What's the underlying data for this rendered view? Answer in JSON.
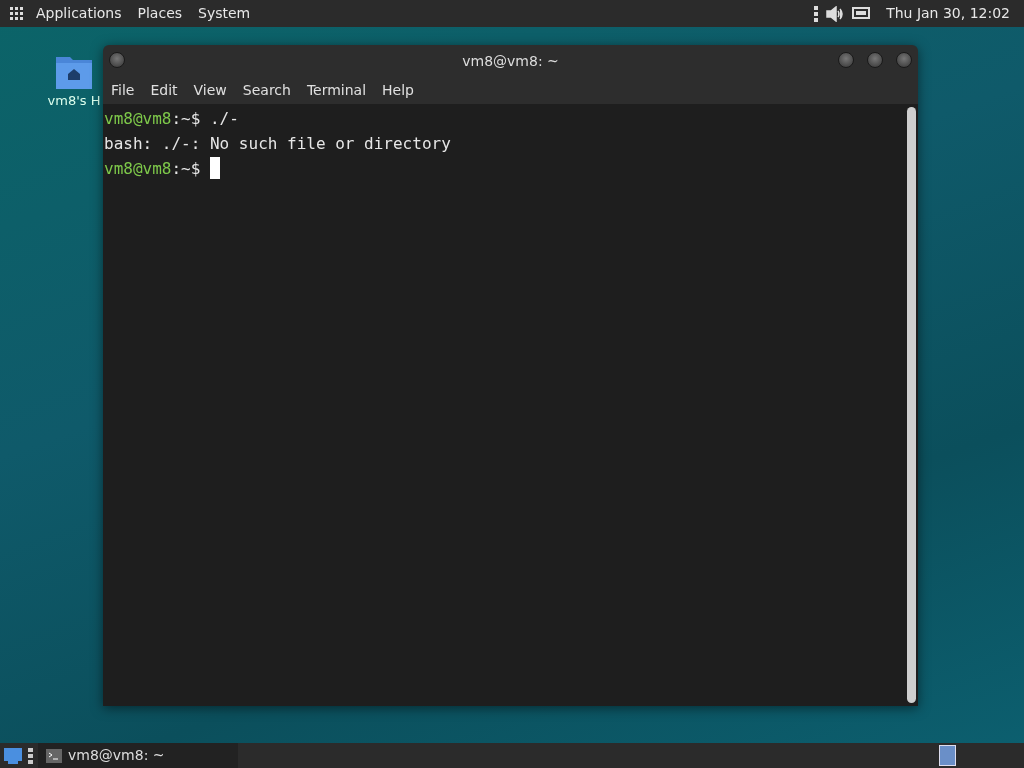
{
  "top_panel": {
    "menus": [
      "Applications",
      "Places",
      "System"
    ],
    "clock": "Thu Jan 30, 12:02"
  },
  "desktop_icons": [
    {
      "label": "vm8's H"
    }
  ],
  "window": {
    "title": "vm8@vm8: ~",
    "menu": [
      "File",
      "Edit",
      "View",
      "Search",
      "Terminal",
      "Help"
    ],
    "lines": [
      {
        "kind": "prompt",
        "host": "vm8@vm8",
        "suffix": ":~$",
        "command": "./-"
      },
      {
        "kind": "output",
        "text": "bash: ./-: No such file or directory"
      },
      {
        "kind": "prompt",
        "host": "vm8@vm8",
        "suffix": ":~$",
        "cursor": true
      }
    ]
  },
  "bottom_panel": {
    "tasks": [
      {
        "label": "vm8@vm8: ~",
        "selected": false
      }
    ],
    "workspaces": [
      {
        "selected": true
      }
    ]
  }
}
